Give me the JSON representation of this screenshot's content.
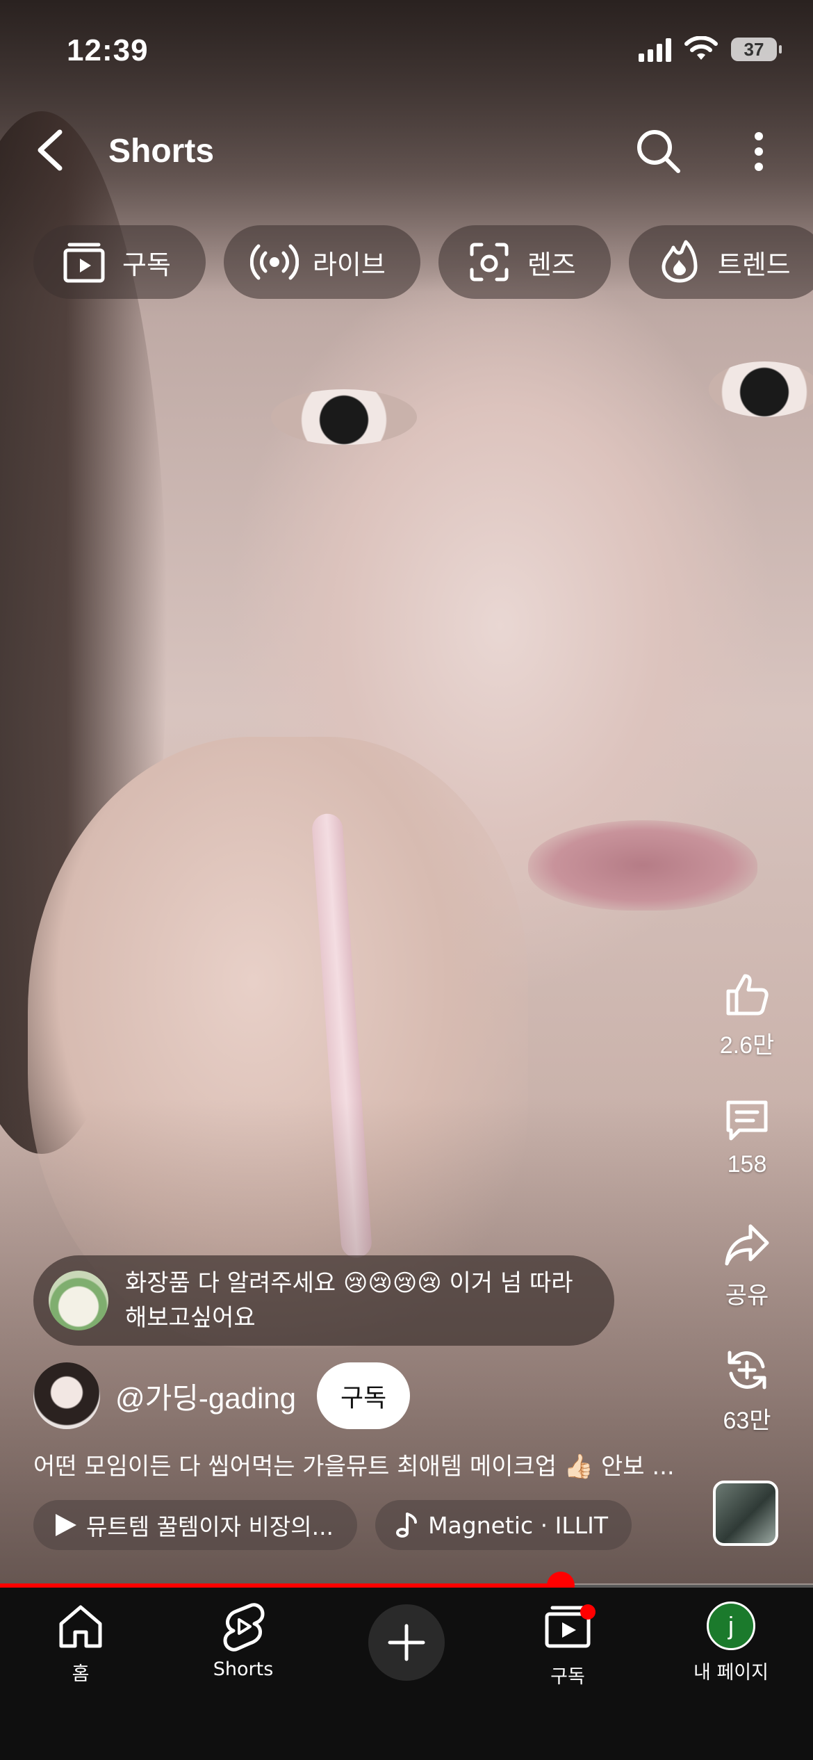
{
  "status_bar": {
    "time": "12:39",
    "battery": "37"
  },
  "header": {
    "title": "Shorts"
  },
  "chips": [
    {
      "label": "구독",
      "icon": "subscriptions-icon"
    },
    {
      "label": "라이브",
      "icon": "live-icon"
    },
    {
      "label": "렌즈",
      "icon": "lens-icon"
    },
    {
      "label": "트렌드",
      "icon": "trend-icon"
    }
  ],
  "actions": {
    "likes": "2.6만",
    "comments": "158",
    "share": "공유",
    "remix": "63만"
  },
  "pinned_comment": {
    "text": "화장품 다 알려주세요 😢😢😢😢 이거 넘 따라해보고싶어요"
  },
  "channel": {
    "handle": "@가딩-gading",
    "subscribe_label": "구독"
  },
  "description": "어떤 모임이든 다 씹어먹는 가을뮤트 최애템 메이크업 👍🏻 안보 ...",
  "tags": {
    "related_video": "뮤트템 꿀템이자 비장의...",
    "music": "Magnetic · ILLIT"
  },
  "progress": {
    "fraction": 0.69
  },
  "nav": {
    "home": "홈",
    "shorts": "Shorts",
    "subscriptions": "구독",
    "profile": "내 페이지",
    "profile_initial": "j"
  },
  "colors": {
    "accent": "#ff0000",
    "nav_bg": "#0f0f0f"
  }
}
